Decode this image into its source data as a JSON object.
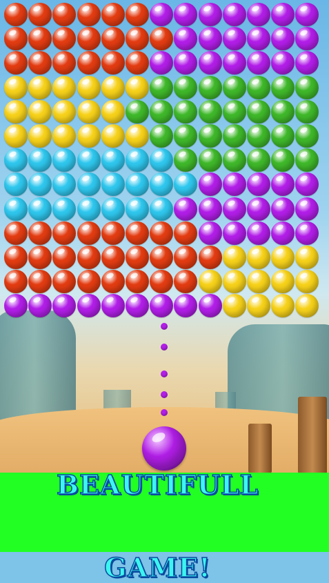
{
  "colors": {
    "red": "#e33c12",
    "purple": "#b21ee8",
    "yellow": "#f7d21a",
    "green": "#3fb82a",
    "cyan": "#2fc7ee",
    "banner_bg": "#22ff22",
    "banner_text": "#3cf5ef"
  },
  "board": {
    "columns": 13,
    "rows": [
      [
        "red",
        "red",
        "red",
        "red",
        "red",
        "red",
        "purple",
        "purple",
        "purple",
        "purple",
        "purple",
        "purple",
        "purple"
      ],
      [
        "red",
        "red",
        "red",
        "red",
        "red",
        "red",
        "red",
        "purple",
        "purple",
        "purple",
        "purple",
        "purple",
        "purple"
      ],
      [
        "red",
        "red",
        "red",
        "red",
        "red",
        "red",
        "purple",
        "purple",
        "purple",
        "purple",
        "purple",
        "purple",
        "purple"
      ],
      [
        "yellow",
        "yellow",
        "yellow",
        "yellow",
        "yellow",
        "yellow",
        "green",
        "green",
        "green",
        "green",
        "green",
        "green",
        "green"
      ],
      [
        "yellow",
        "yellow",
        "yellow",
        "yellow",
        "yellow",
        "green",
        "green",
        "green",
        "green",
        "green",
        "green",
        "green",
        "green"
      ],
      [
        "yellow",
        "yellow",
        "yellow",
        "yellow",
        "yellow",
        "yellow",
        "green",
        "green",
        "green",
        "green",
        "green",
        "green",
        "green"
      ],
      [
        "cyan",
        "cyan",
        "cyan",
        "cyan",
        "cyan",
        "cyan",
        "cyan",
        "green",
        "green",
        "green",
        "green",
        "green",
        "green"
      ],
      [
        "cyan",
        "cyan",
        "cyan",
        "cyan",
        "cyan",
        "cyan",
        "cyan",
        "cyan",
        "purple",
        "purple",
        "purple",
        "purple",
        "purple"
      ],
      [
        "cyan",
        "cyan",
        "cyan",
        "cyan",
        "cyan",
        "cyan",
        "cyan",
        "purple",
        "purple",
        "purple",
        "purple",
        "purple",
        "purple"
      ],
      [
        "red",
        "red",
        "red",
        "red",
        "red",
        "red",
        "red",
        "red",
        "purple",
        "purple",
        "purple",
        "purple",
        "purple"
      ],
      [
        "red",
        "red",
        "red",
        "red",
        "red",
        "red",
        "red",
        "red",
        "red",
        "yellow",
        "yellow",
        "yellow",
        "yellow"
      ],
      [
        "red",
        "red",
        "red",
        "red",
        "red",
        "red",
        "red",
        "red",
        "yellow",
        "yellow",
        "yellow",
        "yellow",
        "yellow"
      ],
      [
        "purple",
        "purple",
        "purple",
        "purple",
        "purple",
        "purple",
        "purple",
        "purple",
        "purple",
        "yellow",
        "yellow",
        "yellow",
        "yellow"
      ]
    ]
  },
  "aim_dots": {
    "color": "purple",
    "count": 5
  },
  "shooter": {
    "color": "purple"
  },
  "banner": {
    "line1": "BEAUTIFULL",
    "line2": "GAME!"
  }
}
